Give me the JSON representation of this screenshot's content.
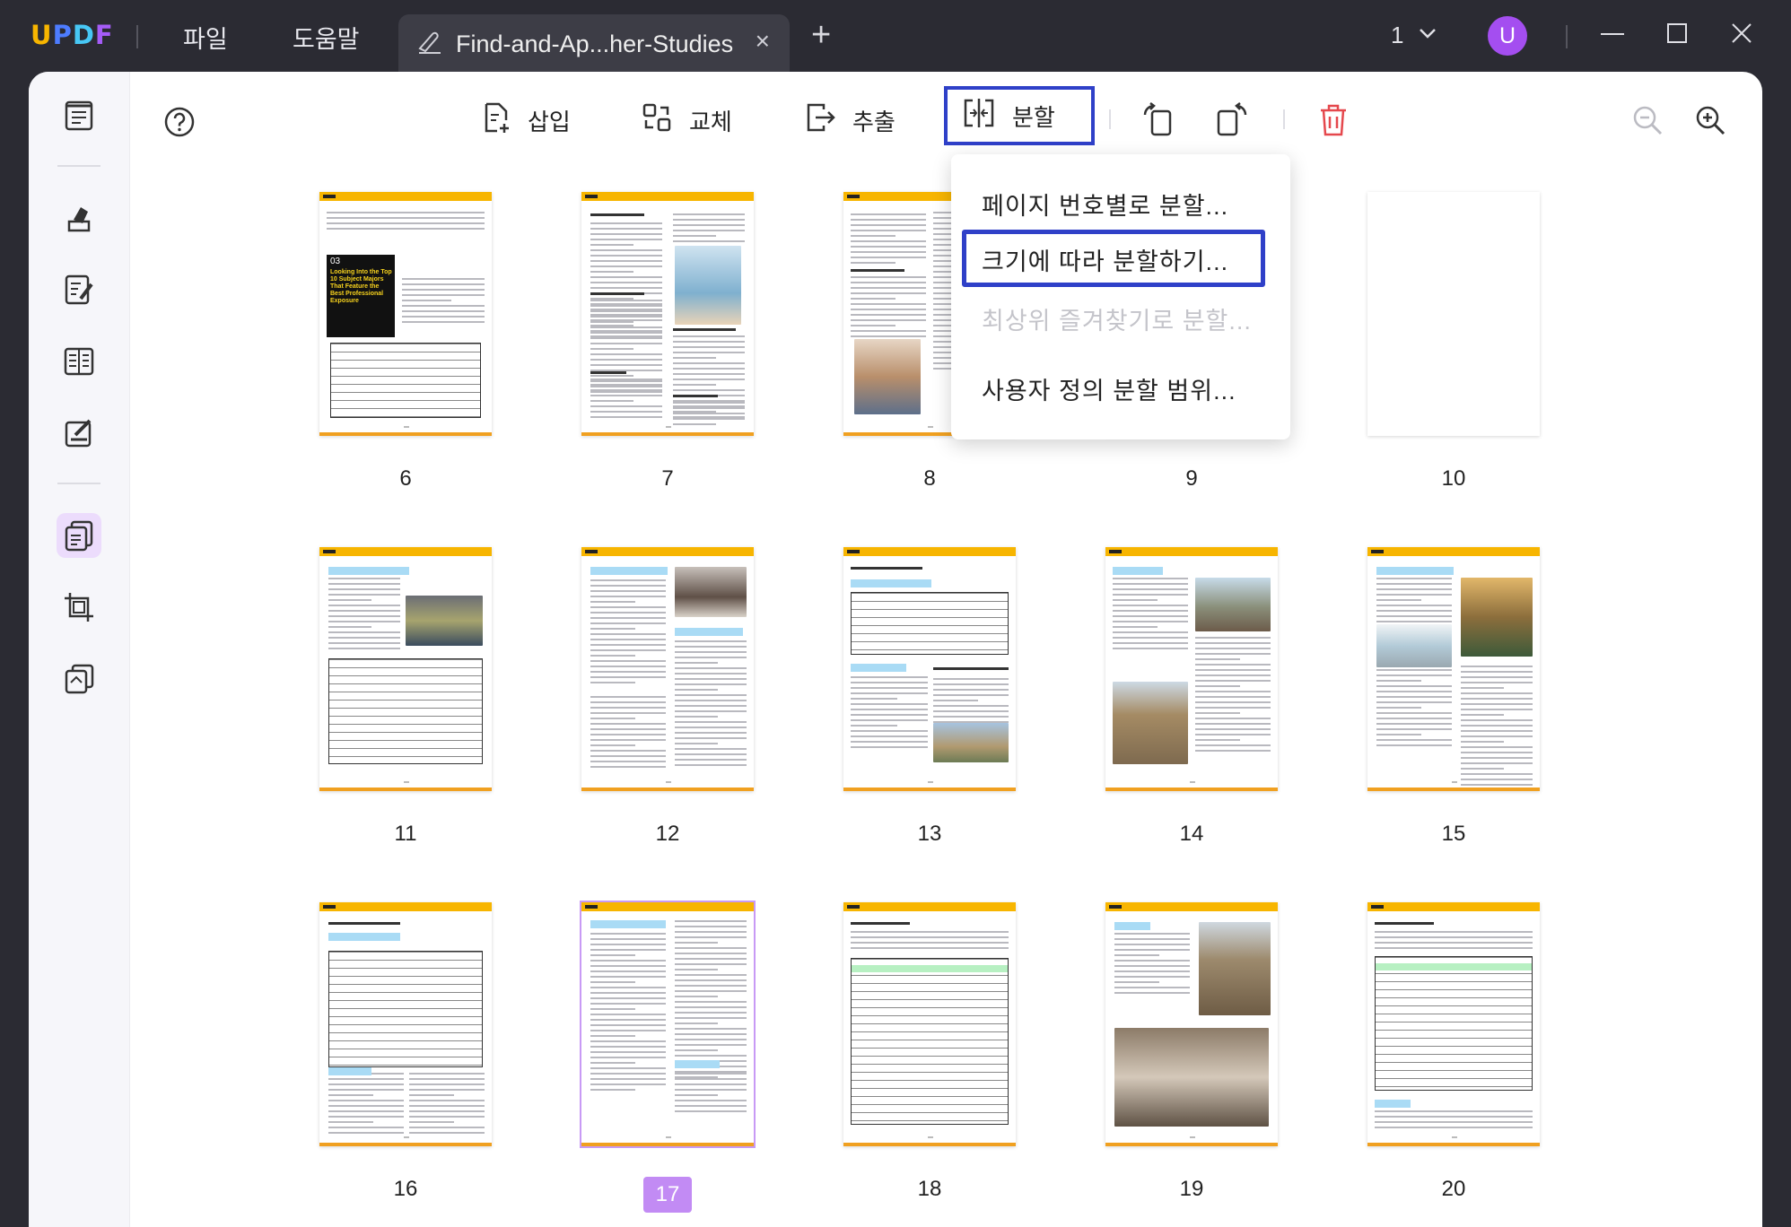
{
  "titlebar": {
    "logo": {
      "u": "U",
      "p": "P",
      "d": "D",
      "f": "F"
    },
    "menus": [
      "파일",
      "도움말"
    ],
    "tab_title": "Find-and-Ap...her-Studies",
    "tab_close": "×",
    "tab_add": "+",
    "page_count": "1",
    "avatar_letter": "U"
  },
  "toolbar": {
    "insert_label": "삽입",
    "replace_label": "교체",
    "extract_label": "추출",
    "split_label": "분할"
  },
  "split_menu": {
    "items": [
      {
        "label": "페이지 번호별로 분할...",
        "enabled": true
      },
      {
        "label": "크기에 따라 분할하기...",
        "enabled": true,
        "highlighted": true
      },
      {
        "label": "최상위 즐겨찾기로 분할...",
        "enabled": false
      },
      {
        "label": "사용자 정의 분할 범위...",
        "enabled": true
      }
    ]
  },
  "pages": [
    {
      "num": "6"
    },
    {
      "num": "7"
    },
    {
      "num": "8"
    },
    {
      "num": "9"
    },
    {
      "num": "10"
    },
    {
      "num": "11"
    },
    {
      "num": "12"
    },
    {
      "num": "13"
    },
    {
      "num": "14"
    },
    {
      "num": "15"
    },
    {
      "num": "16"
    },
    {
      "num": "17",
      "selected": true
    },
    {
      "num": "18"
    },
    {
      "num": "19"
    },
    {
      "num": "20"
    }
  ],
  "thumb_text": {
    "page6_tag": "03",
    "page6_heading": "Looking Into the Top 10 Subject Majors That Feature the Best Professional Exposure"
  },
  "colors": {
    "accent_purple": "#a955f3",
    "highlight_blue": "#2f40c8",
    "brand_yellow": "#f7b500",
    "delete_red": "#e5484d"
  },
  "icons": {
    "help": "help-icon",
    "zoom_out": "zoom-out-icon",
    "zoom_in": "zoom-in-icon",
    "delete": "trash-icon",
    "rotate_left": "rotate-left-icon",
    "rotate_right": "rotate-right-icon"
  }
}
